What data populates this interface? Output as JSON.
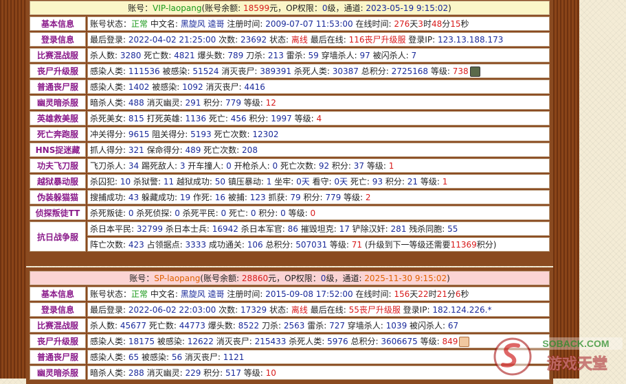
{
  "sec1": {
    "hdr": [
      "账号：",
      "VIP-laopang",
      "(账号余额: ",
      "18599",
      "元，OP权限：",
      "0",
      "级，通道: ",
      "2023-05-19 9:15:02",
      ")"
    ],
    "rows": [
      {
        "label": "基本信息",
        "parts": [
          "账号状态：",
          "正常",
          " 中文名: ",
          "黑旋风 逵哥",
          " 注册时间: ",
          "2009-07-07 11:53:00",
          " 在线时间: ",
          "276",
          "天",
          "3",
          "时",
          "48",
          "分",
          "15",
          "秒"
        ]
      },
      {
        "label": "登录信息",
        "parts": [
          "最后登录: ",
          "2022-04-02 21:25:00",
          " 次数: ",
          "23692",
          " 状态: ",
          "离线",
          " 最后在线: ",
          "116丧尸升级服",
          " 登录IP: ",
          "123.13.188.173"
        ]
      },
      {
        "label": "比赛混战服",
        "parts": [
          "杀人数: ",
          "3280",
          " 死亡数: ",
          "4821",
          " 爆头数: ",
          "789",
          " 刀杀: ",
          "213",
          " 雷杀: ",
          "59",
          " 穿墙杀人: ",
          "97",
          " 被闪杀人: ",
          "7"
        ]
      },
      {
        "label": "丧尸升级服",
        "parts": [
          "感染人类: ",
          "111536",
          " 被感染: ",
          "51524",
          " 消灭丧尸: ",
          "389391",
          " 杀死人类: ",
          "30387",
          " 总积分: ",
          "2725168",
          " 等级: ",
          "738"
        ]
      },
      {
        "label": "普通丧尸服",
        "parts": [
          "感染人类: ",
          "1402",
          " 被感染: ",
          "1092",
          " 消灭丧尸: ",
          "4416"
        ]
      },
      {
        "label": "幽灵暗杀服",
        "parts": [
          "暗杀人类: ",
          "488",
          " 消灭幽灵: ",
          "291",
          " 积分: ",
          "779",
          " 等级: ",
          "12"
        ]
      },
      {
        "label": "英雄救美服",
        "parts": [
          "杀死美女: ",
          "815",
          " 打死英雄: ",
          "1136",
          " 死亡: ",
          "456",
          " 积分: ",
          "1997",
          " 等级: ",
          "4"
        ]
      },
      {
        "label": "死亡奔跑服",
        "parts": [
          "冲关得分: ",
          "9615",
          " 阻关得分: ",
          "5193",
          " 死亡次数: ",
          "12302"
        ]
      },
      {
        "label": "HNS捉迷藏",
        "parts": [
          "抓人得分: ",
          "321",
          " 保命得分: ",
          "489",
          " 死亡次数: ",
          "208"
        ]
      },
      {
        "label": "功夫飞刀服",
        "parts": [
          "飞刀杀人: ",
          "34",
          " 踢死敌人: ",
          "3",
          " 开车撞人: ",
          "0",
          " 开枪杀人: ",
          "0",
          " 死亡次数: ",
          "92",
          " 积分: ",
          "37",
          " 等级: ",
          "1"
        ]
      },
      {
        "label": "越狱暴动服",
        "parts": [
          "杀囚犯: ",
          "10",
          " 杀狱警: ",
          "11",
          " 越狱成功: ",
          "50",
          " 镇压暴动: ",
          "1",
          " 坐牢: ",
          "0天",
          " 看守: ",
          "0天",
          " 死亡: ",
          "93",
          " 积分: ",
          "21",
          " 等级: ",
          "1"
        ]
      },
      {
        "label": "伪装躲猫猫",
        "parts": [
          "搜捕成功: ",
          "43",
          " 躲藏成功: ",
          "19",
          " 作死: ",
          "16",
          " 被捕: ",
          "123",
          " 抓获: ",
          "79",
          " 积分: ",
          "779",
          " 等级: ",
          "2"
        ]
      },
      {
        "label": "侦探叛徒TT",
        "parts": [
          "杀死叛徒: ",
          "0",
          " 杀死侦探: ",
          "0",
          " 杀死平民: ",
          "0",
          " 死亡: ",
          "0",
          " 积分: ",
          "0",
          " 等级: ",
          "0"
        ]
      }
    ],
    "war": {
      "label": "抗日战争服",
      "line1": [
        "杀日本平民: ",
        "32799",
        " 杀日本士兵: ",
        "16942",
        " 杀日本军官: ",
        "86",
        " 摧毁坦克: ",
        "17",
        " 铲除汉奸: ",
        "281",
        " 残杀同胞: ",
        "55"
      ],
      "line2": [
        "阵亡次数: ",
        "423",
        " 占领据点: ",
        "3333",
        " 成功通关: ",
        "106",
        " 总积分: ",
        "507031",
        " 等级: ",
        "71",
        " (升级到下一等级还需要",
        "11369",
        "积分)"
      ]
    }
  },
  "sec2": {
    "hdr": [
      "账号：",
      "SP-laopang",
      "(账号余额: ",
      "28860",
      "元，OP权限：",
      "0",
      "级，通道: ",
      "2025-11-30 9:15:02",
      ")"
    ],
    "rows": [
      {
        "label": "基本信息",
        "parts": [
          "账号状态：",
          "正常",
          " 中文名: ",
          "黑旋风 逵哥",
          " 注册时间: ",
          "2015-09-08 17:52:00",
          " 在线时间: ",
          "156",
          "天",
          "22",
          "时",
          "21",
          "分",
          "6",
          "秒"
        ]
      },
      {
        "label": "登录信息",
        "parts": [
          "最后登录: ",
          "2022-06-02 22:03:00",
          " 次数: ",
          "17329",
          " 状态: ",
          "离线",
          " 最后在线: ",
          "55丧尸升级服",
          " 登录IP: ",
          "182.124.226.*"
        ]
      },
      {
        "label": "比赛混战服",
        "parts": [
          "杀人数: ",
          "45677",
          " 死亡数: ",
          "44773",
          " 爆头数: ",
          "8522",
          " 刀杀: ",
          "2563",
          " 雷杀: ",
          "727",
          " 穿墙杀人: ",
          "1039",
          " 被闪杀人: ",
          "67"
        ]
      },
      {
        "label": "丧尸升级服",
        "parts": [
          "感染人类: ",
          "18175",
          " 被感染: ",
          "12622",
          " 消灭丧尸: ",
          "215433",
          " 杀死人类: ",
          "5976",
          " 总积分: ",
          "3606675",
          " 等级: ",
          "849"
        ]
      },
      {
        "label": "普通丧尸服",
        "parts": [
          "感染人类: ",
          "65",
          " 被感染: ",
          "56",
          " 消灭丧尸: ",
          "1121"
        ]
      },
      {
        "label": "幽灵暗杀服",
        "parts": [
          "暗杀人类: ",
          "288",
          " 消灭幽灵: ",
          "229",
          " 积分: ",
          "517",
          " 等级: ",
          "10"
        ]
      }
    ]
  },
  "watermark": {
    "line1": "SOBACK.COM",
    "line2": "游戏天堂"
  }
}
